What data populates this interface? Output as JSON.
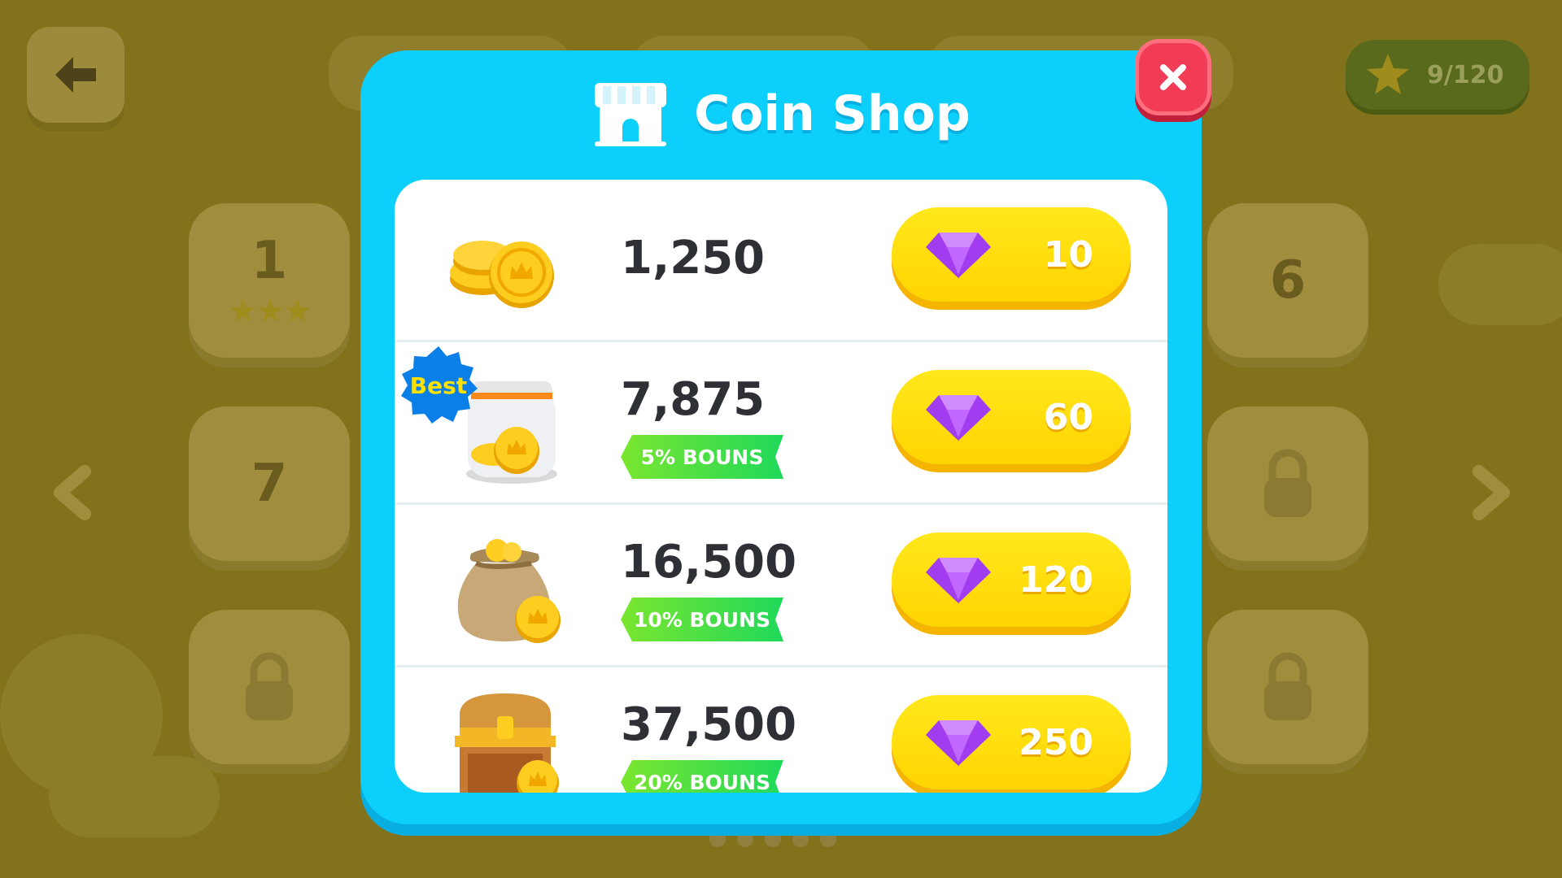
{
  "background": {
    "back_icon": "arrow-left-icon",
    "star_counter": "9/120",
    "tiles": [
      {
        "label": "1",
        "stars": "★★★"
      },
      {
        "label": "6",
        "stars": ""
      },
      {
        "label": "7",
        "stars": ""
      }
    ],
    "locked_icon": "lock-icon"
  },
  "shop": {
    "title": "Coin Shop",
    "title_icon": "shop-icon",
    "close_icon": "close-icon",
    "best_badge": "Best",
    "items": [
      {
        "amount": "1,250",
        "bonus": "",
        "price": "10",
        "art_icon": "coins-pile-icon"
      },
      {
        "amount": "7,875",
        "bonus": "5% BOUNS",
        "price": "60",
        "art_icon": "coin-jar-icon"
      },
      {
        "amount": "16,500",
        "bonus": "10% BOUNS",
        "price": "120",
        "art_icon": "coin-bag-icon"
      },
      {
        "amount": "37,500",
        "bonus": "20% BOUNS",
        "price": "250",
        "art_icon": "treasure-chest-icon"
      }
    ]
  },
  "colors": {
    "modal_bg": "#0cd0fb",
    "buy_button": "#ffd400",
    "bonus_green": "#3fe048",
    "close_red": "#f23b55"
  }
}
